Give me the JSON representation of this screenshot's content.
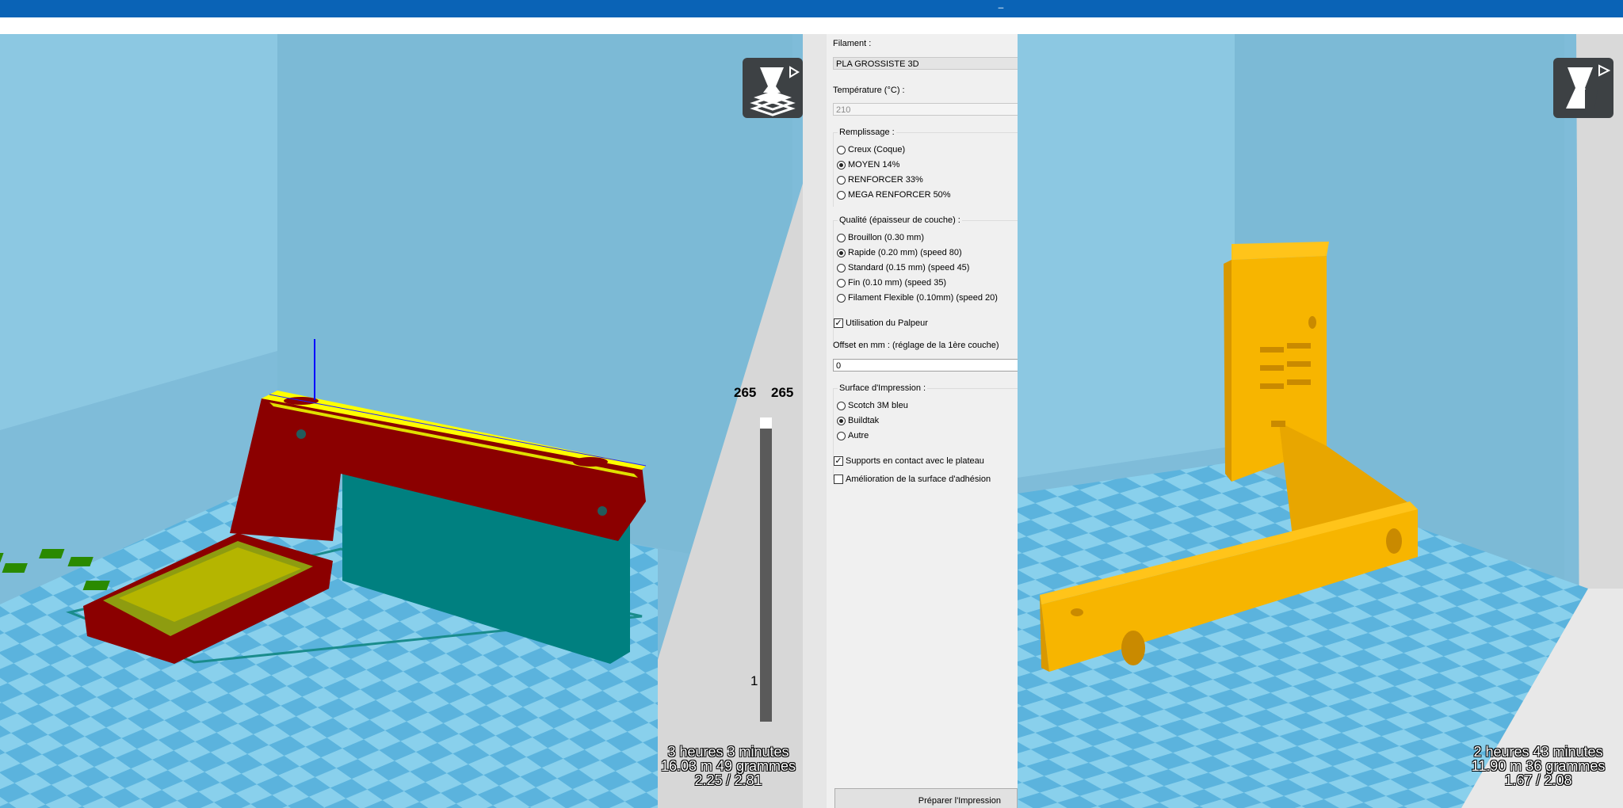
{
  "colors": {
    "titlebar": "#0a63b6",
    "bed_light": "#89d0ec",
    "bed_dark": "#5bb3dd",
    "wall": "#7fbcd9",
    "model_red": "#8b0000",
    "model_yellow": "#ffff00",
    "model_teal": "#008080",
    "model_green": "#2a8a00",
    "model_orange": "#f7b500"
  },
  "icons": {
    "minimize": "minimize-icon",
    "layer_view": "layer-view-icon",
    "model_view": "model-view-icon"
  },
  "left_view": {
    "layer_max_left": "265",
    "layer_max_right": "265",
    "layer_min": "1",
    "stats": {
      "time": "3 heures 3 minutes",
      "material": "16.03 m 49 grammes",
      "cost": "2.25 / 2.81"
    }
  },
  "right_view": {
    "stats": {
      "time": "2 heures 43 minutes",
      "material": "11.90 m 36 grammes",
      "cost": "1.67 / 2.08"
    }
  },
  "settings": {
    "filament_label": "Filament :",
    "filament_value": "PLA GROSSISTE 3D",
    "temperature_label": "Température (°C) :",
    "temperature_value": "210",
    "infill": {
      "title": "Remplissage :",
      "options": [
        "Creux (Coque)",
        "MOYEN 14%",
        "RENFORCER 33%",
        "MEGA RENFORCER 50%"
      ],
      "selected": "MOYEN 14%"
    },
    "quality": {
      "title": "Qualité (épaisseur de couche) :",
      "options": [
        "Brouillon (0.30 mm)",
        "Rapide (0.20 mm) (speed 80)",
        "Standard (0.15 mm) (speed 45)",
        "Fin (0.10 mm) (speed 35)",
        "Filament Flexible (0.10mm) (speed 20)"
      ],
      "selected": "Rapide (0.20 mm) (speed 80)"
    },
    "probe": {
      "label": "Utilisation du Palpeur",
      "checked": true
    },
    "offset_label": "Offset en mm : (réglage de la 1ère couche)",
    "offset_value": "0",
    "surface": {
      "title": "Surface d'Impression :",
      "options": [
        "Scotch 3M bleu",
        "Buildtak",
        "Autre"
      ],
      "selected": "Buildtak"
    },
    "supports": {
      "label": "Supports en contact avec le plateau",
      "checked": true
    },
    "adhesion": {
      "label": "Amélioration de la surface d'adhésion",
      "checked": false
    },
    "prepare_button": "Préparer l'Impression"
  }
}
